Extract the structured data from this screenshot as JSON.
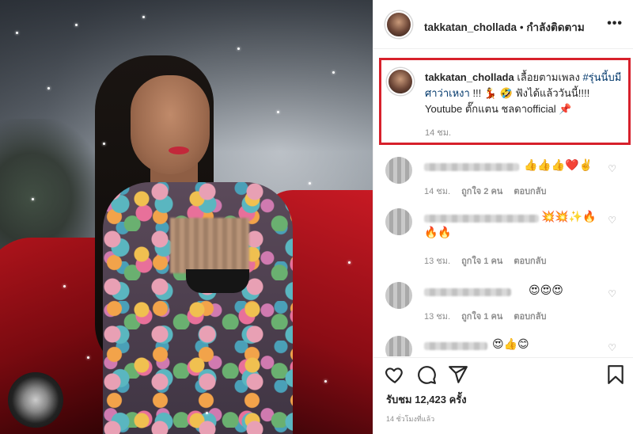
{
  "post": {
    "username": "takkatan_chollada",
    "separator": "•",
    "follow_status": "กำลังติดตาม",
    "more_icon": "more-horizontal-icon"
  },
  "caption": {
    "username": "takkatan_chollada",
    "text_before_tag": "เลื้อยตามเพลง",
    "hashtag": "#รุ่นนี้บมีศาว่าเหงา",
    "text_after_tag": "!!! 💃 🤣 ฟังได้แล้ววันนี้!!!! Youtube ตั๊กแตน ชลดาofficial 📌",
    "time": "14 ชม."
  },
  "comments": [
    {
      "emojis": "👍👍👍❤️✌️",
      "emojis_line2": "",
      "time": "14 ชม.",
      "likes": "ถูกใจ 2 คน",
      "reply": "ตอบกลับ"
    },
    {
      "emojis": "💥💥✨🔥",
      "emojis_line2": "🔥🔥",
      "time": "13 ชม.",
      "likes": "ถูกใจ 1 คน",
      "reply": "ตอบกลับ"
    },
    {
      "emojis": "😍😍😍",
      "emojis_line2": "",
      "time": "13 ชม.",
      "likes": "ถูกใจ 1 คน",
      "reply": "ตอบกลับ"
    },
    {
      "emojis": "😍👍😊",
      "emojis_line2": "",
      "time": "",
      "likes": "",
      "reply": ""
    }
  ],
  "actions": {
    "like_icon": "heart-icon",
    "comment_icon": "comment-icon",
    "share_icon": "send-icon",
    "save_icon": "bookmark-icon",
    "views": "รับชม 12,423 ครั้ง",
    "posted_ago": "14 ชั่วโมงที่แล้ว"
  },
  "colors": {
    "highlight_border": "#d7202b",
    "hashtag": "#00376b",
    "secondary_text": "#8e8e8e"
  }
}
